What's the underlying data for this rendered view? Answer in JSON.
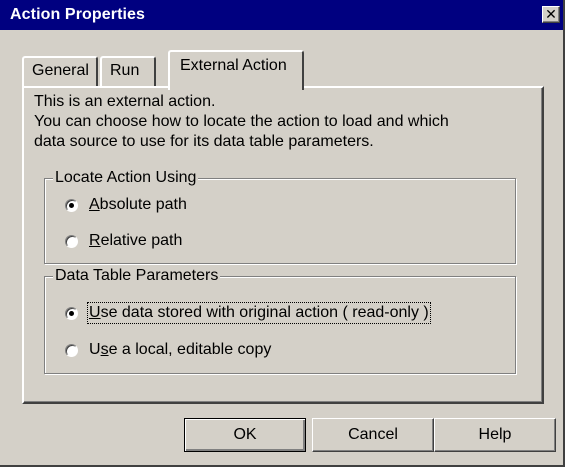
{
  "window": {
    "title": "Action Properties",
    "close_symbol": "✕"
  },
  "tabs": [
    {
      "label": "General",
      "active": false
    },
    {
      "label": "Run",
      "active": false
    },
    {
      "label": "External Action",
      "active": true
    }
  ],
  "description": {
    "line1": "This is an external action.",
    "line2": "You can choose how to locate the action to load and which",
    "line3": "data source to use for its data table parameters."
  },
  "locate_group": {
    "legend": "Locate Action Using",
    "options": [
      {
        "mnemonic": "A",
        "rest": "bsolute path",
        "checked": true
      },
      {
        "mnemonic": "R",
        "rest": "elative path",
        "checked": false
      }
    ]
  },
  "datatable_group": {
    "legend": "Data Table Parameters",
    "options": [
      {
        "mnemonic": "U",
        "rest": "se data stored with original action ( read-only )",
        "checked": true
      },
      {
        "prefix": "U",
        "mnemonic": "s",
        "rest": "e a local, editable copy",
        "checked": false
      }
    ]
  },
  "buttons": {
    "ok": "OK",
    "cancel": "Cancel",
    "help": "Help"
  },
  "colors": {
    "titlebar": "#000080",
    "face": "#d4d0c8"
  }
}
